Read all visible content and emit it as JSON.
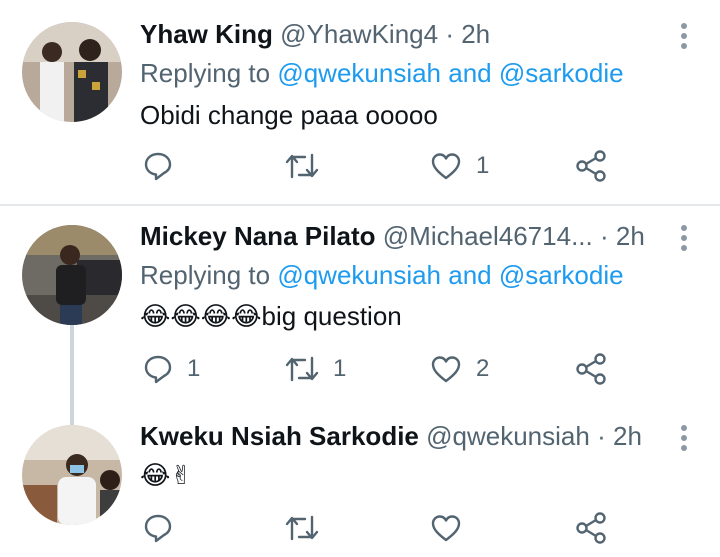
{
  "tweets": [
    {
      "name": "Yhaw King",
      "handle": "@YhawKing4",
      "separator": "·",
      "time": "2h",
      "replying_prefix": "Replying to",
      "mention1": "@qwekunsiah",
      "and_text": "and",
      "mention2": "@sarkodie",
      "text": "Obidi change paaa ooooo",
      "replies": "",
      "retweets": "",
      "likes": "1"
    },
    {
      "name": "Mickey Nana Pilato",
      "handle": "@Michael46714...",
      "separator": "·",
      "time": "2h",
      "replying_prefix": "Replying to",
      "mention1": "@qwekunsiah",
      "and_text": "and",
      "mention2": "@sarkodie",
      "emoji": "😂😂😂😂",
      "text": "big question",
      "replies": "1",
      "retweets": "1",
      "likes": "2"
    },
    {
      "name": "Kweku Nsiah Sarkodie",
      "handle": "@qwekunsiah",
      "separator": "·",
      "time": "2h",
      "emoji": "😂✌",
      "replies": "",
      "retweets": "",
      "likes": ""
    }
  ],
  "colors": {
    "mention": "#1d9bf0",
    "secondary_text": "#536471",
    "divider": "#e4e8eb",
    "thread_line": "#cdd5dc"
  },
  "icons": [
    "reply-icon",
    "retweet-icon",
    "like-icon",
    "share-icon",
    "more-options-icon"
  ]
}
